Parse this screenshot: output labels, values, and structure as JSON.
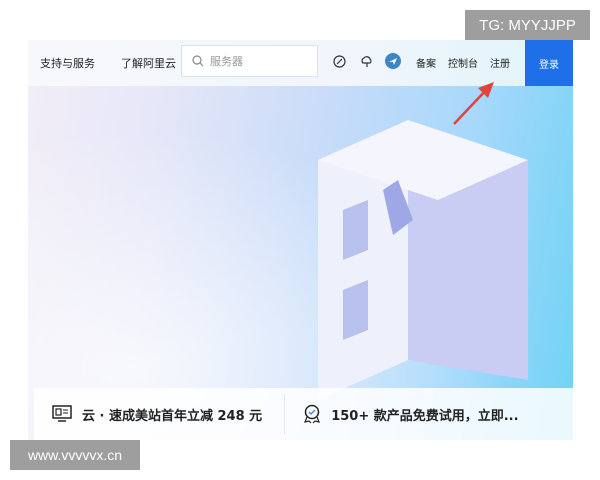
{
  "header": {
    "nav": [
      "支持与服务",
      "了解阿里云"
    ],
    "search_placeholder": "服务器",
    "icons": [
      "speedometer-icon",
      "cloud-icon",
      "app-logo-icon"
    ],
    "links": [
      "备案",
      "控制台",
      "注册"
    ],
    "login": "登录"
  },
  "promos": [
    {
      "icon": "monitor-icon",
      "text": "云 · 速成美站首年立减 248 元"
    },
    {
      "icon": "badge-icon",
      "text": "150+ 款产品免费试用，立即..."
    }
  ],
  "watermarks": {
    "top": "TG: MYYJJPP",
    "bottom": "www.vvvvvx.cn"
  },
  "colors": {
    "login_bg": "#1f6fe8",
    "arrow": "#e0453a"
  }
}
